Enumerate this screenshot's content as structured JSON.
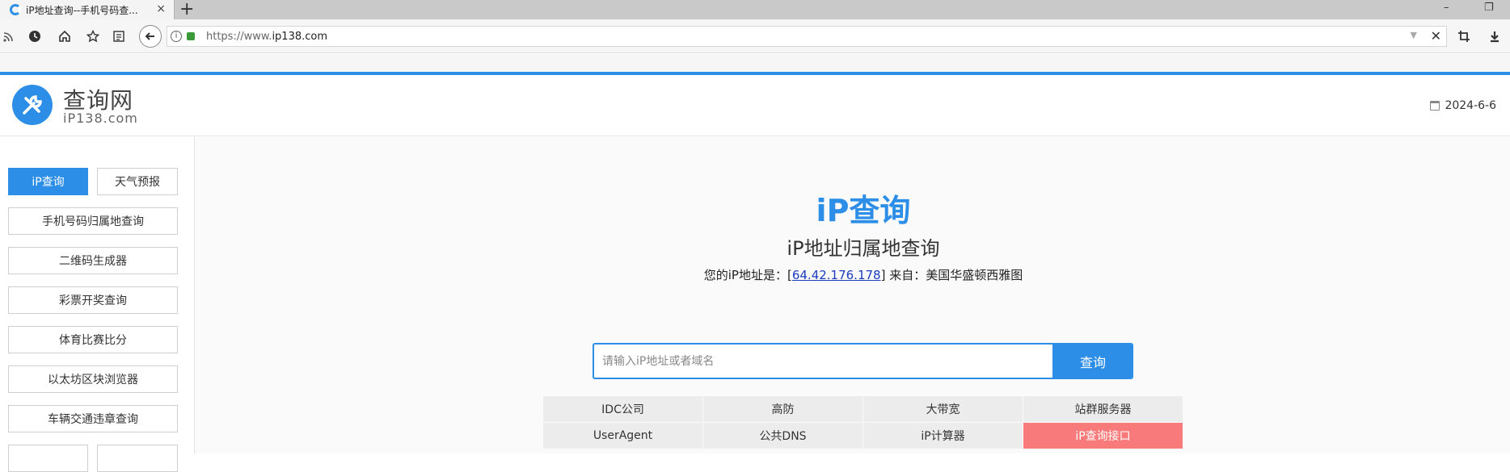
{
  "browser": {
    "tab_title": "iP地址查询--手机号码查...",
    "tab_close": "×",
    "new_tab": "+",
    "url_prefix": "https://www.",
    "url_host": "ip138.com",
    "url_info": "i",
    "window_minimize": "–",
    "window_restore": "❐",
    "icons": [
      "rss-icon",
      "history-icon",
      "home-icon",
      "bookmark-star-icon",
      "reader-icon",
      "back-arrow-icon",
      "crop-icon",
      "download-icon"
    ]
  },
  "header": {
    "logo_name": "查询网",
    "logo_domain": "iP138.com",
    "date": "2024-6-6"
  },
  "sidebar": {
    "items": [
      {
        "label": "iP查询",
        "active": true
      },
      {
        "label": "天气预报"
      },
      {
        "label": "手机号码归属地查询"
      },
      {
        "label": "二维码生成器"
      },
      {
        "label": "彩票开奖查询"
      },
      {
        "label": "体育比赛比分"
      },
      {
        "label": "以太坊区块浏览器"
      },
      {
        "label": "车辆交通违章查询"
      }
    ]
  },
  "main": {
    "title": "iP查询",
    "subtitle": "iP地址归属地查询",
    "ip_prefix": "您的iP地址是：[",
    "ip_value": "64.42.176.178",
    "ip_suffix": "] 来自：美国华盛顿西雅图",
    "search_placeholder": "请输入iP地址或者域名",
    "search_button": "查询",
    "links": [
      {
        "label": "IDC公司"
      },
      {
        "label": "高防"
      },
      {
        "label": "大带宽"
      },
      {
        "label": "站群服务器"
      },
      {
        "label": "UserAgent"
      },
      {
        "label": "公共DNS"
      },
      {
        "label": "iP计算器"
      },
      {
        "label": "iP查询接口",
        "highlight": true
      }
    ]
  },
  "colors": {
    "brand_blue": "#2c8ee6",
    "highlight_red": "#f87a7a"
  }
}
